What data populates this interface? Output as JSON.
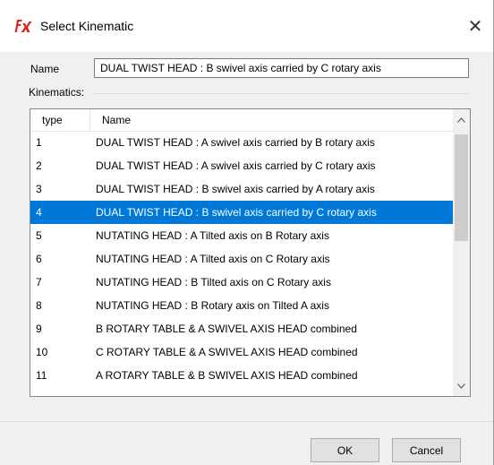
{
  "window": {
    "title": "Select Kinematic",
    "icon": "fx-logo-icon",
    "close_symbol": "✕"
  },
  "name_field": {
    "label": "Name",
    "value": "DUAL TWIST HEAD : B swivel axis carried by C rotary axis"
  },
  "kinematics": {
    "label": "Kinematics:",
    "columns": [
      "type",
      "Name"
    ],
    "selected_index": 3,
    "rows": [
      {
        "type": "1",
        "name": "DUAL TWIST HEAD : A swivel axis carried by B rotary axis"
      },
      {
        "type": "2",
        "name": "DUAL TWIST HEAD : A swivel axis carried by C rotary axis"
      },
      {
        "type": "3",
        "name": "DUAL TWIST HEAD : B swivel axis carried by A rotary axis"
      },
      {
        "type": "4",
        "name": "DUAL TWIST HEAD : B swivel axis carried by C rotary axis"
      },
      {
        "type": "5",
        "name": "NUTATING HEAD : A Tilted axis on B Rotary axis"
      },
      {
        "type": "6",
        "name": "NUTATING HEAD : A Tilted axis on C Rotary axis"
      },
      {
        "type": "7",
        "name": "NUTATING HEAD : B Tilted axis on C Rotary axis"
      },
      {
        "type": "8",
        "name": "NUTATING HEAD : B Rotary axis on Tilted A axis"
      },
      {
        "type": "9",
        "name": "B ROTARY TABLE & A SWIVEL AXIS HEAD combined"
      },
      {
        "type": "10",
        "name": "C ROTARY TABLE & A SWIVEL AXIS HEAD combined"
      },
      {
        "type": "11",
        "name": "A ROTARY TABLE & B SWIVEL AXIS HEAD combined"
      }
    ]
  },
  "buttons": {
    "ok": "OK",
    "cancel": "Cancel"
  },
  "colors": {
    "selection": "#0078d7",
    "logo": "#d9261c"
  }
}
